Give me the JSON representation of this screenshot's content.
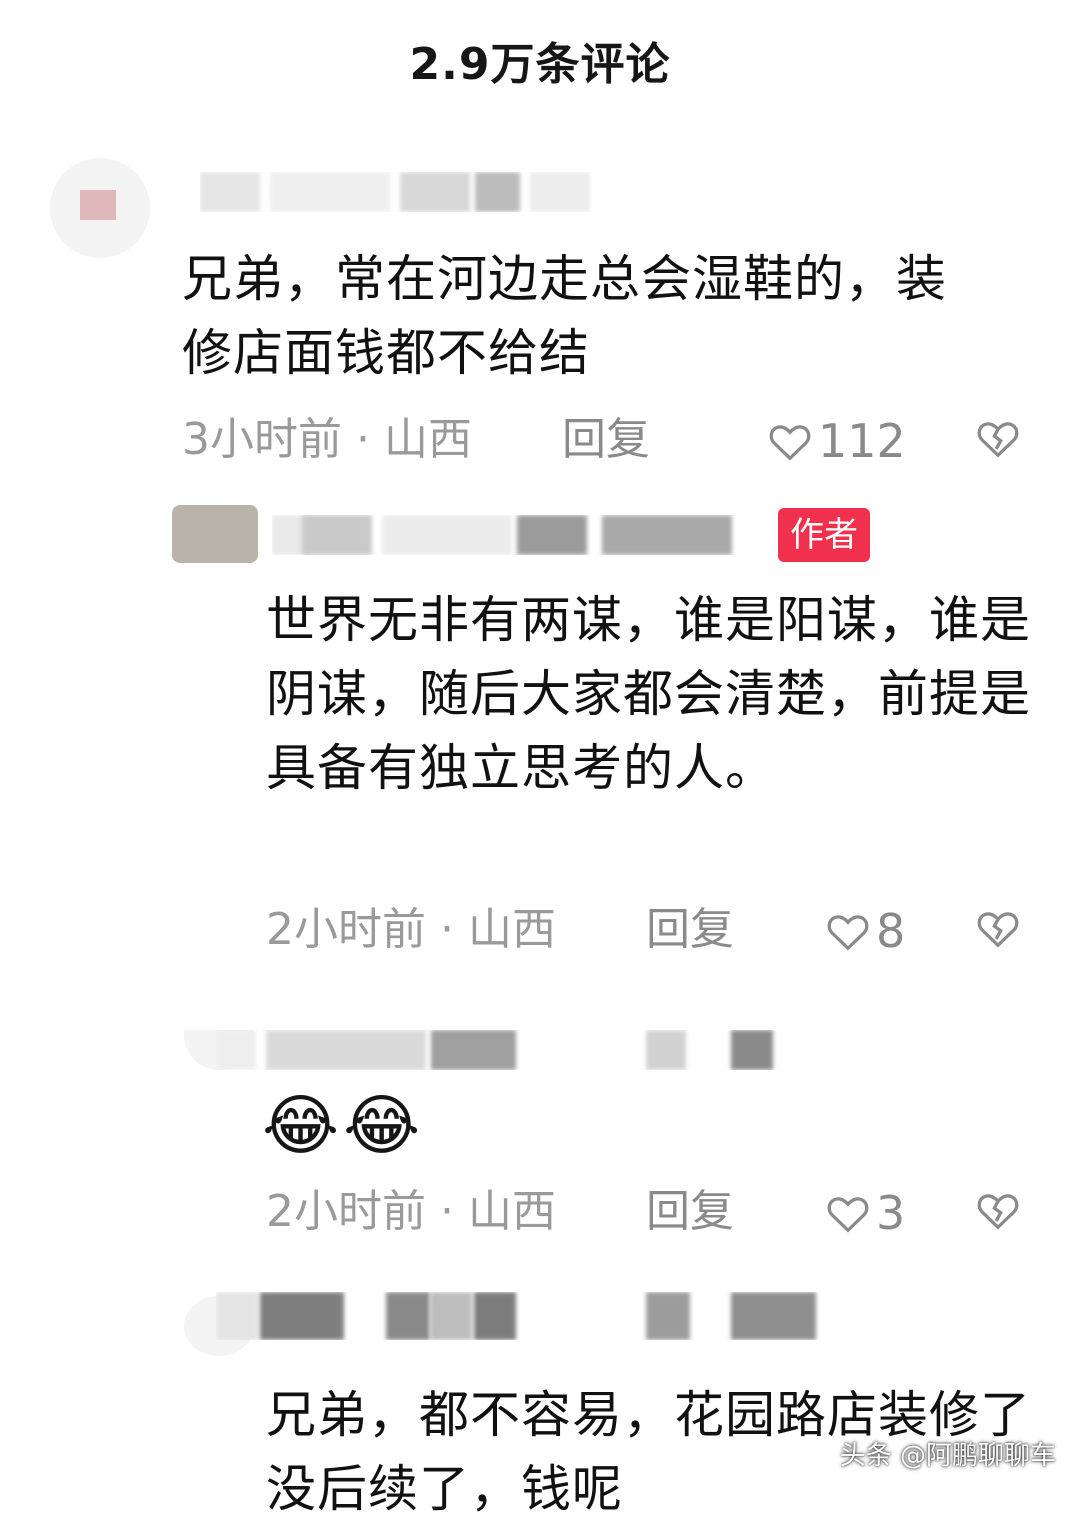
{
  "header": {
    "title": "2.9万条评论"
  },
  "comments": [
    {
      "text": "兄弟，常在河边走总会湿鞋的，装修店面钱都不给结",
      "time": "3小时前",
      "location": "山西",
      "reply": "回复",
      "likes": "112"
    },
    {
      "author_tag": "作者",
      "text": "世界无非有两谋，谁是阳谋，谁是阴谋，随后大家都会清楚，前提是具备有独立思考的人。",
      "time": "2小时前",
      "location": "山西",
      "reply": "回复",
      "likes": "8"
    },
    {
      "emojis": [
        "😂",
        "😂"
      ],
      "time": "2小时前",
      "location": "山西",
      "reply": "回复",
      "likes": "3"
    },
    {
      "text": "兄弟，都不容易，花园路店装修了没后续了，钱呢"
    }
  ],
  "watermark": "头条 @阿鹏聊聊车",
  "icons": {
    "like": "heart-outline-icon",
    "dislike": "broken-heart-icon"
  },
  "colors": {
    "author_tag": "#f0304c",
    "meta": "#9a9a9a"
  }
}
